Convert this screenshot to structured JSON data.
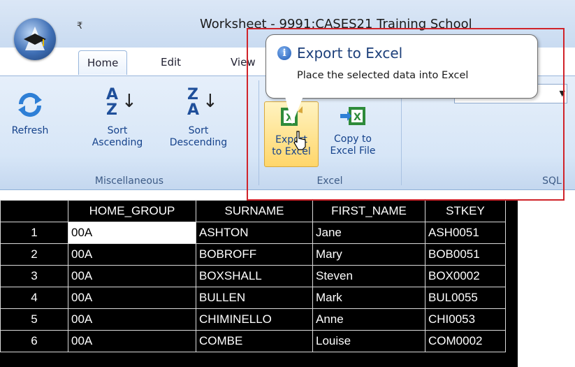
{
  "window": {
    "title": "Worksheet - 9991:CASES21 Training School",
    "qat_dropdown": "₹"
  },
  "tabs": [
    {
      "label": "Home",
      "active": true
    },
    {
      "label": "Edit",
      "active": false
    },
    {
      "label": "View",
      "active": false
    }
  ],
  "ribbon": {
    "groups": {
      "miscellaneous": "Miscellaneous",
      "excel": "Excel",
      "sql": "SQL"
    },
    "buttons": {
      "refresh": "Refresh",
      "sort_asc_1": "Sort",
      "sort_asc_2": "Ascending",
      "sort_desc_1": "Sort",
      "sort_desc_2": "Descending",
      "export_1": "Export",
      "export_2": "to Excel",
      "copy_1": "Copy to",
      "copy_2": "Excel File"
    },
    "sort_icon_asc": {
      "top": "A",
      "bottom": "Z"
    },
    "sort_icon_desc": {
      "top": "Z",
      "bottom": "A"
    }
  },
  "tooltip": {
    "title": "Export to Excel",
    "description": "Place the selected data into Excel"
  },
  "grid": {
    "columns": [
      "HOME_GROUP",
      "SURNAME",
      "FIRST_NAME",
      "STKEY"
    ],
    "rows": [
      {
        "num": "1",
        "home_group": "00A",
        "surname": "ASHTON",
        "first_name": "Jane",
        "stkey": "ASH0051"
      },
      {
        "num": "2",
        "home_group": "00A",
        "surname": "BOBROFF",
        "first_name": "Mary",
        "stkey": "BOB0051"
      },
      {
        "num": "3",
        "home_group": "00A",
        "surname": "BOXSHALL",
        "first_name": "Steven",
        "stkey": "BOX0002"
      },
      {
        "num": "4",
        "home_group": "00A",
        "surname": "BULLEN",
        "first_name": "Mark",
        "stkey": "BUL0055"
      },
      {
        "num": "5",
        "home_group": "00A",
        "surname": "CHIMINELLO",
        "first_name": "Anne",
        "stkey": "CHI0053"
      },
      {
        "num": "6",
        "home_group": "00A",
        "surname": "COMBE",
        "first_name": "Louise",
        "stkey": "COM0002"
      }
    ]
  },
  "colors": {
    "highlight": "#d0232a",
    "ribbon": "#d7e6f7",
    "grid_background": "#000000"
  },
  "icons": [
    "app-orb-icon",
    "refresh-icon",
    "sort-ascending-icon",
    "sort-descending-icon",
    "excel-export-icon",
    "excel-copy-icon",
    "info-icon",
    "mouse-cursor-icon"
  ]
}
